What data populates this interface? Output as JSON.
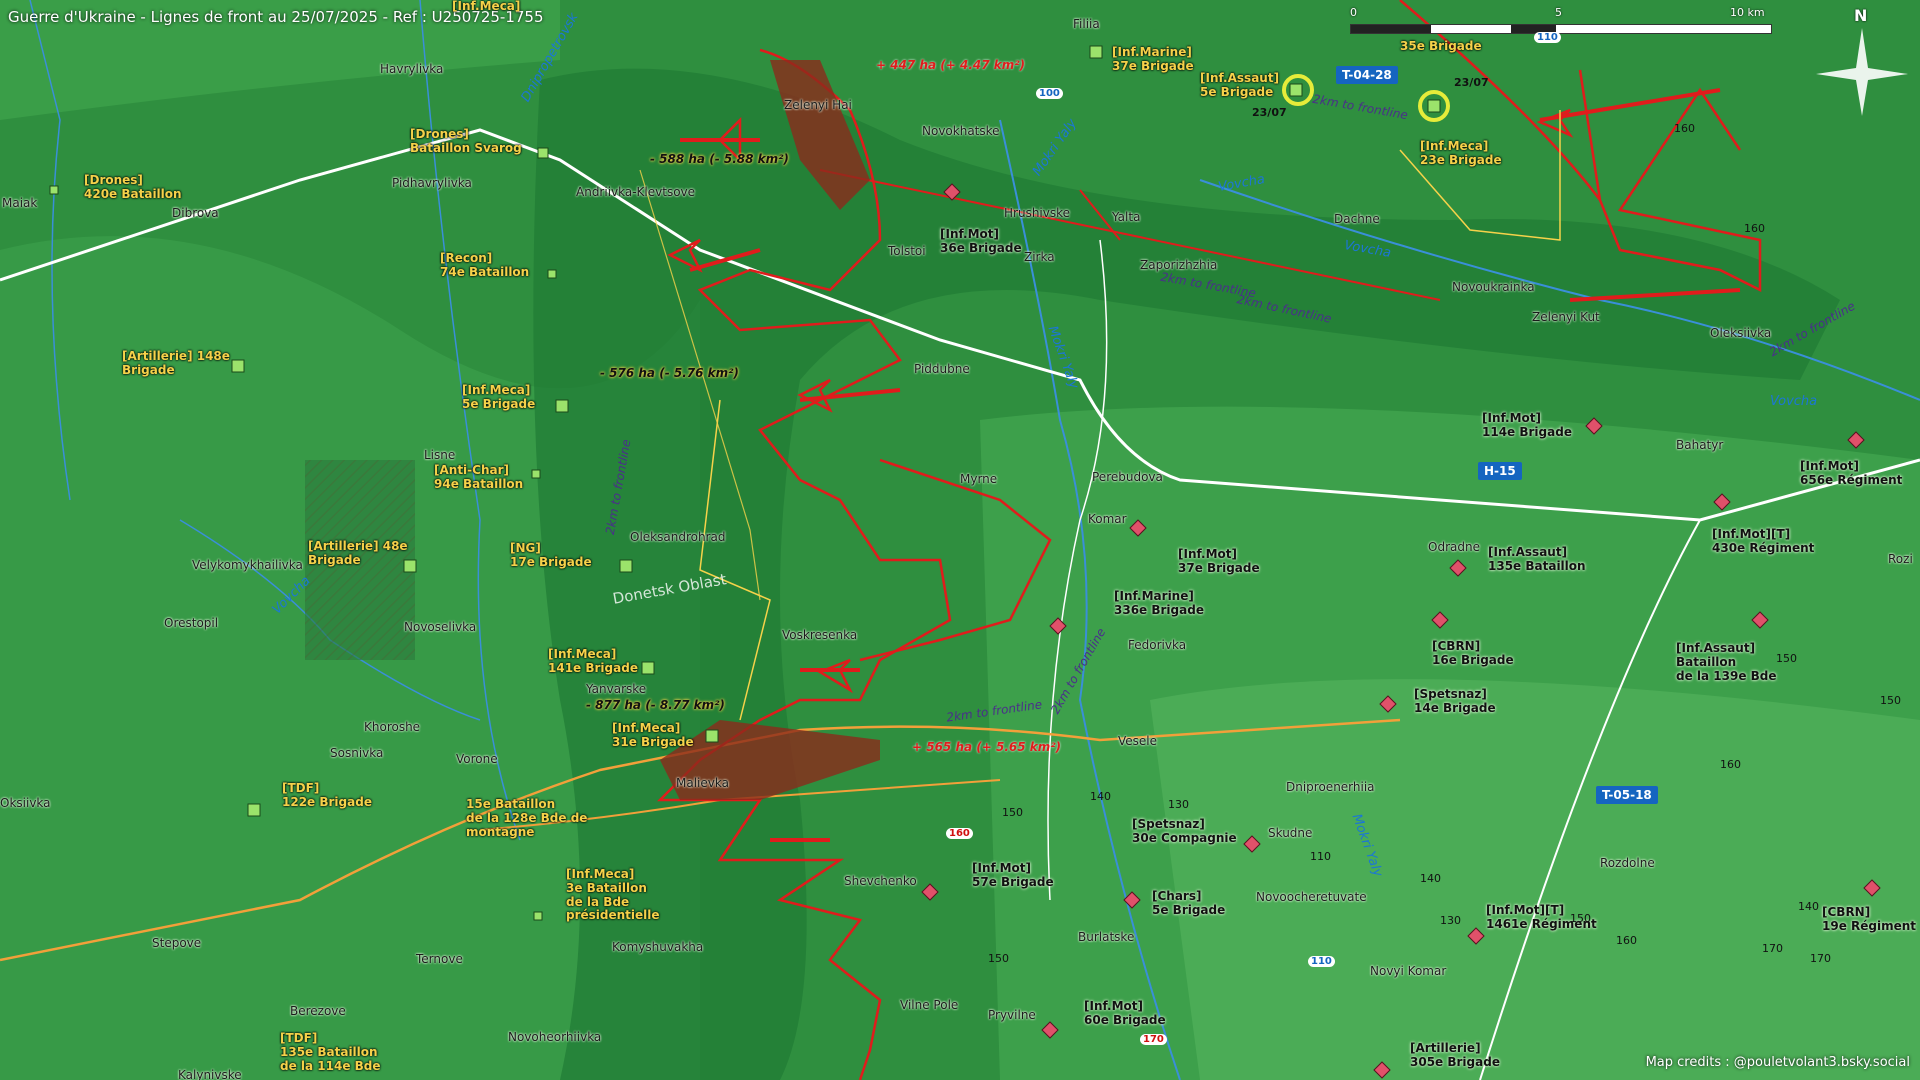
{
  "title": "Guerre d'Ukraine - Lignes de front au 25/07/2025 - Ref : U250725-1755",
  "credit": "Map credits : @pouletvolant3.bsky.social",
  "scale": {
    "l0": "0",
    "l5": "5",
    "l10": "10 km"
  },
  "north": "N",
  "colors": {
    "terrain": "#2f8f3f",
    "frontline": "#e01c1c",
    "ua_label": "#f5d24a",
    "ru_symbol": "#e0516a",
    "ua_symbol": "#9be36b",
    "road_sign": "#1565c0"
  },
  "ua_units": [
    {
      "label": "[Inf.Meca]"
    },
    {
      "label": "[Drones]\nBataillon Svarog"
    },
    {
      "label": "[Drones]\n420e Bataillon"
    },
    {
      "label": "[Recon]\n74e Bataillon"
    },
    {
      "label": "[Artillerie] 148e\nBrigade"
    },
    {
      "label": "[Inf.Meca]\n5e Brigade"
    },
    {
      "label": "[Anti-Char]\n94e Bataillon"
    },
    {
      "label": "[Artillerie] 48e\nBrigade"
    },
    {
      "label": "[NG]\n17e Brigade"
    },
    {
      "label": "[Inf.Meca]\n141e Brigade"
    },
    {
      "label": "[Inf.Meca]\n31e Brigade"
    },
    {
      "label": "[TDF]\n122e Brigade"
    },
    {
      "label": "15e Bataillon\nde la 128e Bde de\nmontagne"
    },
    {
      "label": "[Inf.Meca]\n3e Bataillon\nde la Bde\nprésidentielle"
    },
    {
      "label": "[TDF]\n135e Bataillon\nde la 114e Bde"
    },
    {
      "label": "[Inf.Marine]\n37e Brigade"
    },
    {
      "label": "[Inf.Assaut]\n5e Brigade"
    },
    {
      "label": "[Inf.Meca]\n23e Brigade"
    },
    {
      "label": "35e Brigade"
    }
  ],
  "ru_units": [
    {
      "label": "[Inf.Mot]\n36e Brigade"
    },
    {
      "label": "[Inf.Mot]\n114e Brigade"
    },
    {
      "label": "[Inf.Mot]\n656e Régiment"
    },
    {
      "label": "[Inf.Mot][T]\n430e Régiment"
    },
    {
      "label": "[Inf.Mot]\n37e Brigade"
    },
    {
      "label": "[Inf.Assaut]\n135e Bataillon"
    },
    {
      "label": "[Inf.Marine]\n336e Brigade"
    },
    {
      "label": "[CBRN]\n16e Brigade"
    },
    {
      "label": "[Inf.Assaut]\nBataillon\nde la 139e Bde"
    },
    {
      "label": "[Spetsnaz]\n14e Brigade"
    },
    {
      "label": "[Spetsnaz]\n30e Compagnie"
    },
    {
      "label": "[Inf.Mot]\n57e Brigade"
    },
    {
      "label": "[Chars]\n5e Brigade"
    },
    {
      "label": "[Inf.Mot][T]\n1461e Régiment"
    },
    {
      "label": "[CBRN]\n19e Régiment"
    },
    {
      "label": "[Inf.Mot]\n60e Brigade"
    },
    {
      "label": "[Artillerie]\n305e Brigade"
    }
  ],
  "places": [
    "Filiia",
    "Havrylivka",
    "Zelenyi Hai",
    "Novokhatske",
    "Maiak",
    "Pidhavrylivka",
    "Andriivka-Klevtsove",
    "Dibrova",
    "Hrushivske",
    "Tolstoi",
    "Yalta",
    "Zirka",
    "Zaporizhzhia",
    "Dachne",
    "Novoukrainka",
    "Zelenyi Kut",
    "Oleksiivka",
    "Piddubne",
    "Lisne",
    "Myrne",
    "Perebudova",
    "Komar",
    "Bahatyr",
    "Oleksandrohrad",
    "Velykomykhailivka",
    "Orestopil",
    "Novoselivka",
    "Voskresenka",
    "Odradne",
    "Fedorivka",
    "Yanvarske",
    "Khoroshe",
    "Sosnivka",
    "Vorone",
    "Malievka",
    "Veselе",
    "Dniproenerhiia",
    "Skudne",
    "Shevchenko",
    "Burlatske",
    "Novoocheretuvate",
    "Novyi Komar",
    "Komyshuvakha",
    "Stepove",
    "Ternove",
    "Berezove",
    "Novoheorhiivka",
    "Vilne Pole",
    "Pryvilne",
    "Rozdolne",
    "Kalynivske",
    "Oksiivka",
    "Rozi"
  ],
  "gains": [
    {
      "label": "+ 447 ha (+ 4.47 km²)"
    },
    {
      "label": "+ 565 ha (+ 5.65 km²)"
    }
  ],
  "losses": [
    {
      "label": "- 588 ha (- 5.88 km²)"
    },
    {
      "label": "- 576 ha (- 5.76 km²)"
    },
    {
      "label": "- 877 ha (- 8.77 km²)"
    }
  ],
  "road_signs": [
    "T-04-28",
    "H-15",
    "T-05-18"
  ],
  "route_numbers": [
    "100",
    "110",
    "110",
    "160",
    "170"
  ],
  "zones": [
    "2km to frontline",
    "2km to frontline",
    "2km to frontline",
    "2km to frontline",
    "2km to frontline",
    "2km to frontline",
    "2km to frontline"
  ],
  "rivers": [
    "Vovcha",
    "Vovcha",
    "Vovcha",
    "Vovcha",
    "Mokri Yaly",
    "Mokri Yaly",
    "Mokri Yaly",
    "Dnipropetrovsk"
  ],
  "oblast": "Donetsk Oblast",
  "elevations": [
    "160",
    "160",
    "150",
    "150",
    "160",
    "170",
    "140",
    "130",
    "150",
    "140",
    "130",
    "110",
    "140",
    "150",
    "150",
    "170",
    "160"
  ],
  "dates": [
    "23/07",
    "23/07"
  ]
}
